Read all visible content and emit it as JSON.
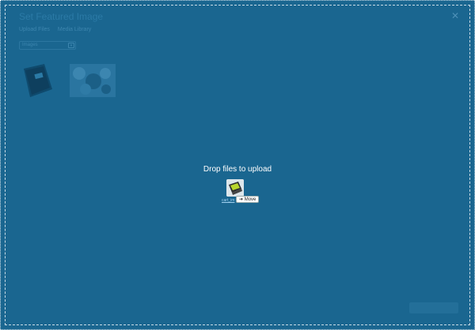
{
  "modal": {
    "title": "Set Featured Image",
    "close_icon": "close-icon"
  },
  "tabs": [
    "Upload Files",
    "Media Library"
  ],
  "filter": {
    "selected": "Images"
  },
  "library": {
    "thumbnails": [
      {
        "kind": "book-photo"
      },
      {
        "kind": "device-photo"
      }
    ]
  },
  "dropzone": {
    "label": "Drop files to upload",
    "drag_file_name": "cart_im",
    "tooltip": "Move"
  },
  "colors": {
    "overlay": "#1a6690",
    "dropzone_text": "#ffffff"
  }
}
